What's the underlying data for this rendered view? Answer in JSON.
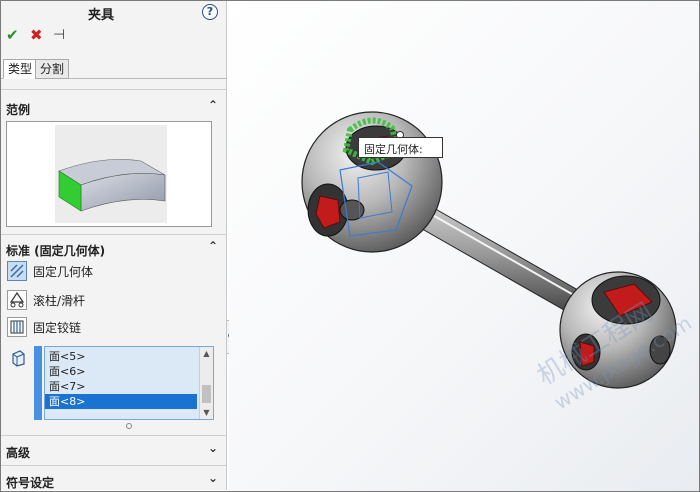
{
  "panel": {
    "title": "夹具",
    "help_glyph": "?",
    "actions": {
      "ok_glyph": "✔",
      "cancel_glyph": "✖",
      "pin_glyph": "⊣"
    },
    "tabs": [
      {
        "label": "类型",
        "active": true
      },
      {
        "label": "分割",
        "active": false
      }
    ],
    "example_section": {
      "label": "范例",
      "chevron": "⌃"
    },
    "standard_section": {
      "label": "标准 (固定几何体)",
      "chevron": "⌃",
      "options": [
        {
          "label": "固定几何体",
          "icon": "fixed-geometry-icon",
          "selected": true
        },
        {
          "label": "滚柱/滑杆",
          "icon": "roller-slider-icon",
          "selected": false
        },
        {
          "label": "固定铰链",
          "icon": "fixed-hinge-icon",
          "selected": false
        }
      ],
      "faces": [
        {
          "label": "面<5>",
          "selected": false
        },
        {
          "label": "面<6>",
          "selected": false
        },
        {
          "label": "面<7>",
          "selected": false
        },
        {
          "label": "面<8>",
          "selected": true
        }
      ],
      "scroll_up_glyph": "▲",
      "scroll_down_glyph": "▼"
    },
    "advanced_section": {
      "label": "高级",
      "chevron": "⌄"
    },
    "symbol_section": {
      "label": "符号设定",
      "chevron": "⌄"
    }
  },
  "viewport": {
    "tooltip": "固定几何体:",
    "watermark_line1": "机械工程网",
    "watermark_line2": "www.jxage.com"
  },
  "colors": {
    "selection_blue": "#1a73d2",
    "fixture_green": "#3fbf3f",
    "socket_red": "#c21b1b"
  }
}
